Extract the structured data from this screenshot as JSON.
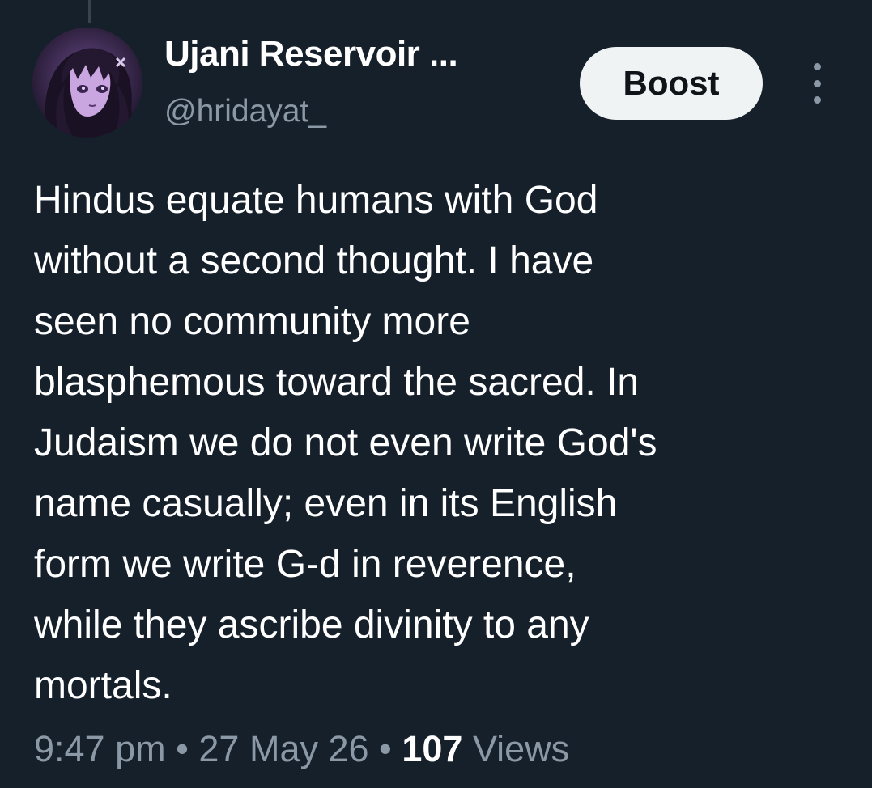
{
  "author": {
    "display_name": "Ujani Reservoir ...",
    "handle": "@hridayat_",
    "avatar_icon": "anime-avatar"
  },
  "boost_button": {
    "label": "Boost"
  },
  "more_icon": "more-vertical-icon",
  "tweet": {
    "lines": [
      "Hindus equate humans with God",
      "without a second thought. I have",
      "seen no community more",
      "blasphemous toward the sacred. In",
      "Judaism we do not even write God's",
      "name casually; even in its English",
      "form we write G-d in reverence,",
      "while they ascribe divinity to any",
      "mortals."
    ]
  },
  "meta": {
    "time": "9:47 pm",
    "separator": "•",
    "date": "27 May 26",
    "views_count": "107",
    "views_label": "Views"
  },
  "colors": {
    "background": "#15202b",
    "secondary_text": "#8b98a5",
    "button_bg": "#eff3f4"
  }
}
